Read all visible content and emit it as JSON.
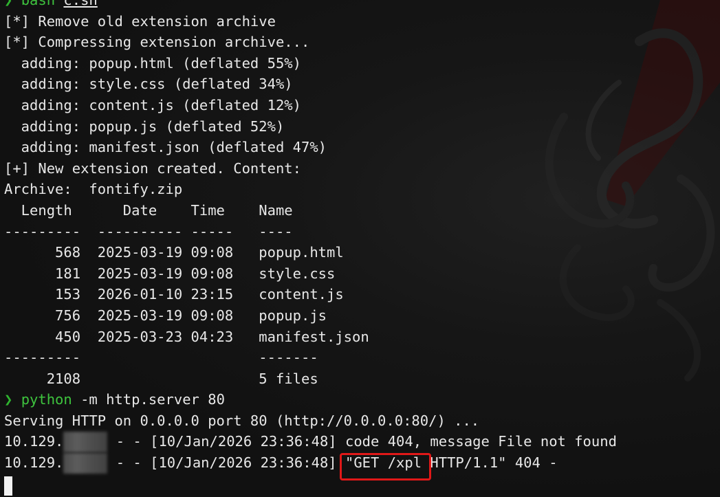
{
  "prompt_symbol": "❯",
  "line0": {
    "cmd": "bash",
    "arg": "c.sh"
  },
  "line1": "[*] Remove old extension archive",
  "line2": "[*] Compressing extension archive...",
  "adding": [
    "  adding: popup.html (deflated 55%)",
    "  adding: style.css (deflated 34%)",
    "  adding: content.js (deflated 12%)",
    "  adding: popup.js (deflated 52%)",
    "  adding: manifest.json (deflated 47%)"
  ],
  "line8": "[+] New extension created. Content:",
  "line9": "Archive:  fontify.zip",
  "table_header": "  Length      Date    Time    Name",
  "table_rule": "---------  ---------- -----   ----",
  "table_rows": [
    "      568  2025-03-19 09:08   popup.html",
    "      181  2025-03-19 09:08   style.css",
    "      153  2026-01-10 23:15   content.js",
    "      756  2025-03-19 09:08   popup.js",
    "      450  2025-03-23 04:23   manifest.json"
  ],
  "table_footer_rule": "---------                     -------",
  "table_total": "     2108                     5 files",
  "line20": {
    "cmd": "python",
    "args": " -m http.server 80"
  },
  "line21": "Serving HTTP on 0.0.0.0 port 80 (http://0.0.0.0:80/) ...",
  "log_ip_prefix": "10.129.",
  "log1_rest": " - - [10/Jan/2026 23:36:48] code 404, message File not found",
  "log2_mid": " - - [10/Jan/2026 23:36:48] ",
  "log2_highlighted": "\"GET /xpl ",
  "log2_tail": "HTTP/1.1\" 404 -",
  "colors": {
    "background": "#111111",
    "text": "#e8e8e8",
    "prompt_green": "#3ec43e",
    "highlight_red": "#e01818"
  }
}
